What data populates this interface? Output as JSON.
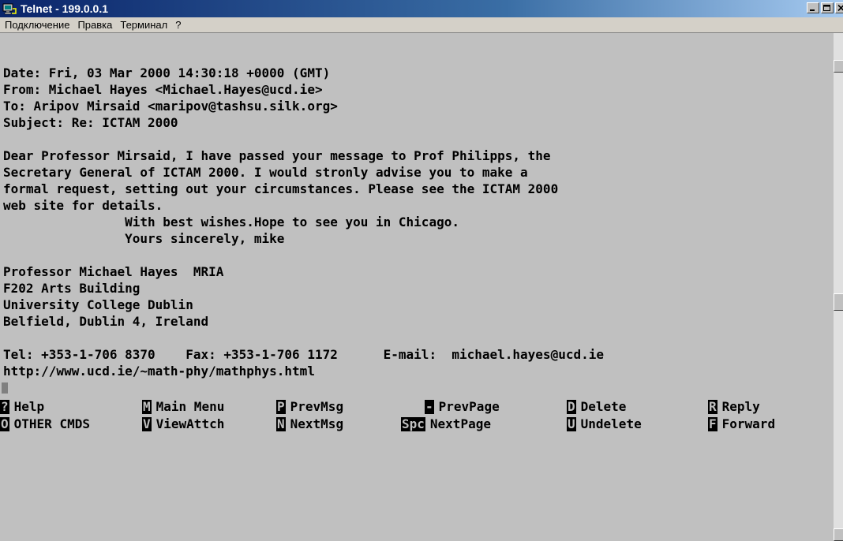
{
  "window": {
    "title": "Telnet - 199.0.0.1",
    "controls": [
      "minimize-icon",
      "maximize-icon",
      "close-icon"
    ]
  },
  "menubar": {
    "items": [
      {
        "label": "Подключение"
      },
      {
        "label": "Правка"
      },
      {
        "label": "Терминал"
      },
      {
        "label": "?"
      }
    ]
  },
  "terminal": {
    "lines": [
      "",
      "Date: Fri, 03 Mar 2000 14:30:18 +0000 (GMT)",
      "From: Michael Hayes <Michael.Hayes@ucd.ie>",
      "To: Aripov Mirsaid <maripov@tashsu.silk.org>",
      "Subject: Re: ICTAM 2000",
      "",
      "Dear Professor Mirsaid, I have passed your message to Prof Philipps, the",
      "Secretary General of ICTAM 2000. I would stronly advise you to make a",
      "formal request, setting out your circumstances. Please see the ICTAM 2000",
      "web site for details.",
      "                With best wishes.Hope to see you in Chicago.",
      "                Yours sincerely, mike",
      "",
      "Professor Michael Hayes  MRIA",
      "F202 Arts Building",
      "University College Dublin",
      "Belfield, Dublin 4, Ireland",
      "",
      "Tel: +353-1-706 8370    Fax: +353-1-706 1172      E-mail:  michael.hayes@ucd.ie",
      "http://www.ucd.ie/~math-phy/mathphys.html"
    ]
  },
  "commands": {
    "row1": [
      {
        "key": "?",
        "label": "Help"
      },
      {
        "key": "M",
        "label": "Main Menu"
      },
      {
        "key": "P",
        "label": "PrevMsg"
      },
      {
        "key": "-",
        "label": "PrevPage"
      },
      {
        "key": "D",
        "label": "Delete"
      },
      {
        "key": "R",
        "label": "Reply"
      }
    ],
    "row2": [
      {
        "key": "O",
        "label": "OTHER CMDS"
      },
      {
        "key": "V",
        "label": "ViewAttch"
      },
      {
        "key": "N",
        "label": "NextMsg"
      },
      {
        "key": "Spc",
        "label": "NextPage"
      },
      {
        "key": "U",
        "label": "Undelete"
      },
      {
        "key": "F",
        "label": "Forward"
      }
    ]
  }
}
